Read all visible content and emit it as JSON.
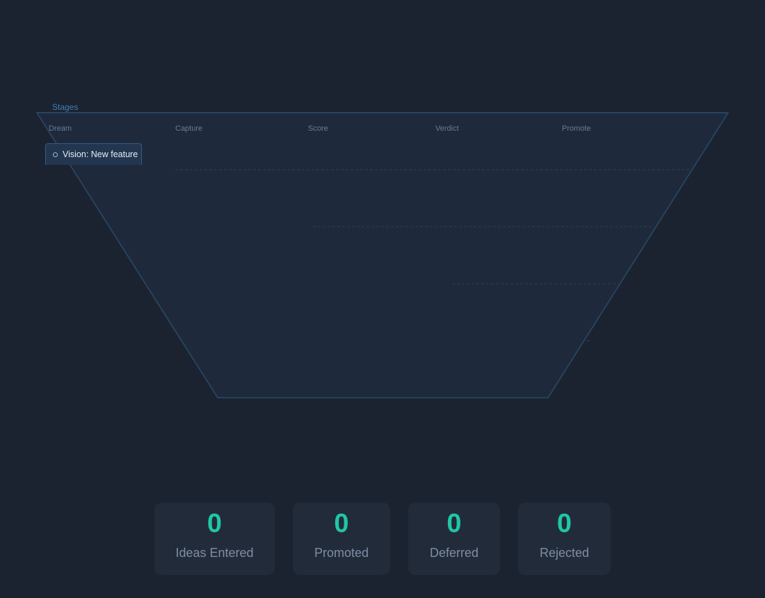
{
  "funnel": {
    "stages_label": "Stages",
    "stages": [
      "Dream",
      "Capture",
      "Score",
      "Verdict",
      "Promote"
    ]
  },
  "ideas": [
    {
      "label": "Vision: New feature",
      "icon": "circle-icon"
    }
  ],
  "stats": [
    {
      "value": "0",
      "label": "Ideas Entered"
    },
    {
      "value": "0",
      "label": "Promoted"
    },
    {
      "value": "0",
      "label": "Deferred"
    },
    {
      "value": "0",
      "label": "Rejected"
    }
  ],
  "colors": {
    "background": "#1b2331",
    "funnel_fill": "#1e2a3c",
    "funnel_stroke": "#2a4a68",
    "accent_teal": "#1fc7a6",
    "card_bg": "#222b3a"
  }
}
